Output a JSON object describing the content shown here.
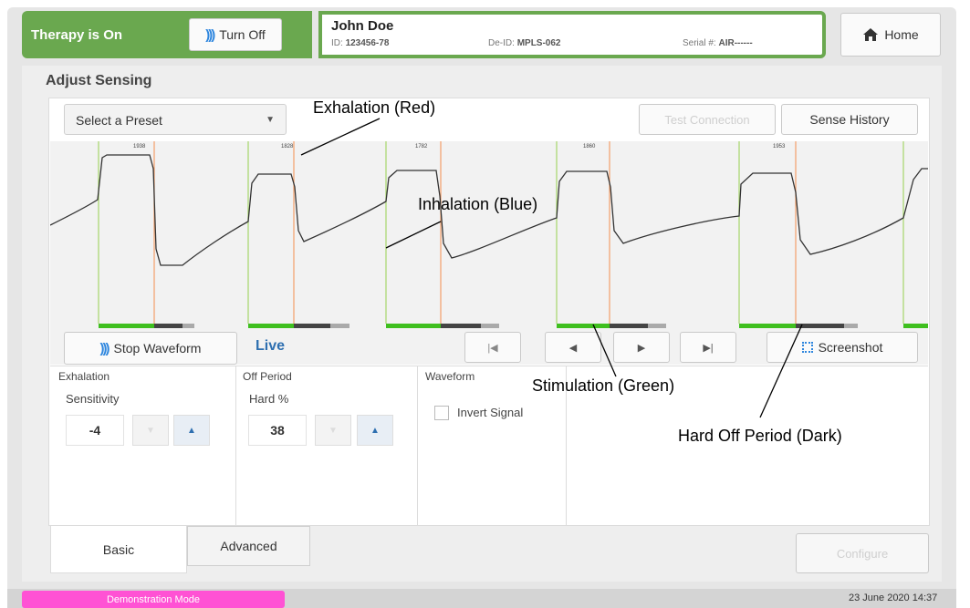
{
  "header": {
    "therapy_status": "Therapy is On",
    "turn_off_label": "Turn Off",
    "patient_name": "John Doe",
    "id_label": "ID:",
    "id_value": "123456-78",
    "deid_label": "De-ID:",
    "deid_value": "MPLS-062",
    "serial_label": "Serial #:",
    "serial_value": "AIR------",
    "home_label": "Home"
  },
  "page_title": "Adjust Sensing",
  "toolbar": {
    "preset_placeholder": "Select a Preset",
    "test_connection": "Test Connection",
    "sense_history": "Sense History"
  },
  "waveform": {
    "cycle_labels": [
      "1938",
      "1828",
      "1782",
      "1860",
      "1953"
    ],
    "colors": {
      "inhalation": "#a6d66b",
      "exhalation": "#f4a06a",
      "stimulation": "#3fbf1f",
      "hard_off": "#444444"
    }
  },
  "controls": {
    "stop_waveform": "Stop Waveform",
    "live": "Live",
    "screenshot": "Screenshot"
  },
  "settings": {
    "exhalation_title": "Exhalation",
    "sensitivity_label": "Sensitivity",
    "sensitivity_value": "-4",
    "off_period_title": "Off Period",
    "hard_label": "Hard %",
    "hard_value": "38",
    "waveform_title": "Waveform",
    "invert_signal": "Invert Signal"
  },
  "tabs": {
    "basic": "Basic",
    "advanced": "Advanced",
    "configure": "Configure"
  },
  "footer": {
    "mode": "Demonstration Mode",
    "datetime": "23 June 2020 14:37"
  },
  "annotations": {
    "exhalation": "Exhalation (Red)",
    "inhalation": "Inhalation (Blue)",
    "stimulation": "Stimulation (Green)",
    "hard_off": "Hard Off Period (Dark)"
  }
}
